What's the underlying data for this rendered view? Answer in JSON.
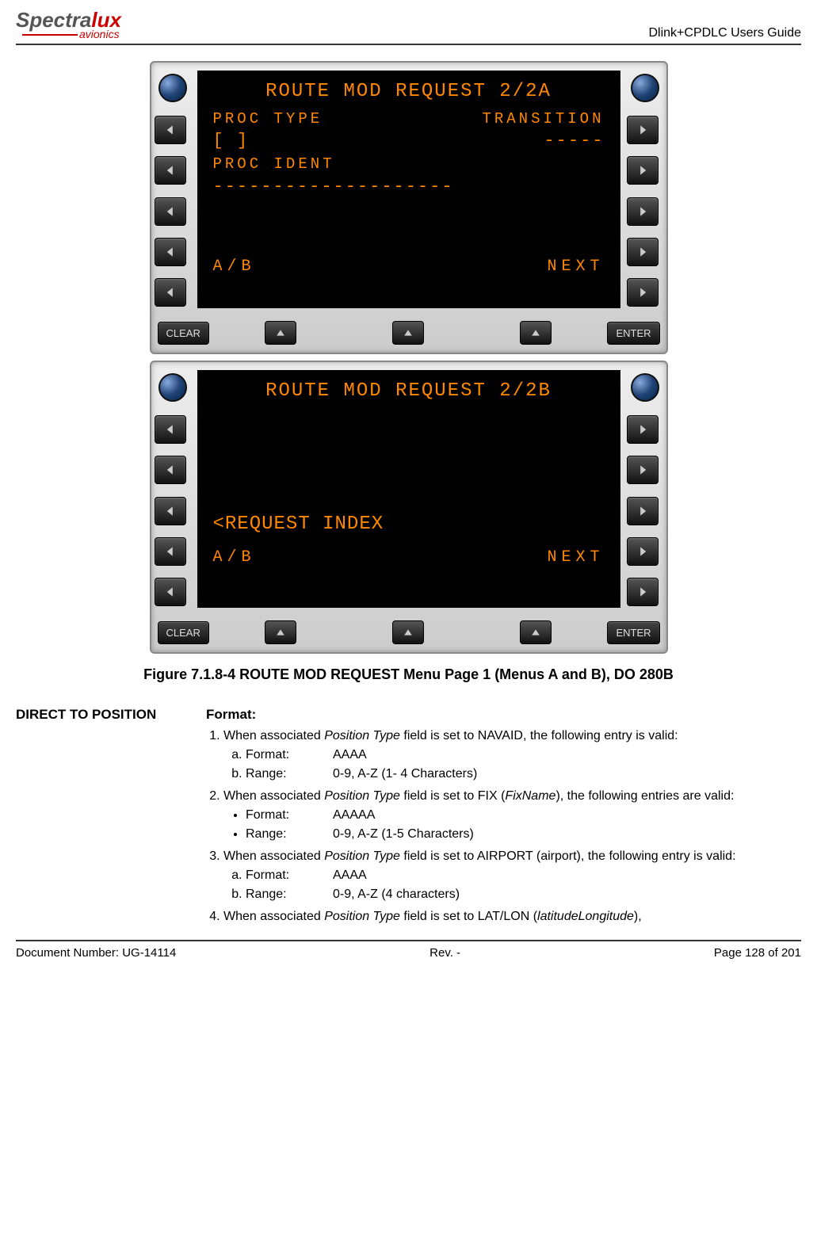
{
  "header": {
    "logo_part1": "Spectra",
    "logo_part2": "lux",
    "logo_sub": "avionics",
    "title": "Dlink+CPDLC Users Guide"
  },
  "cdu_a": {
    "title": "ROUTE MOD REQUEST 2/2A",
    "label_left": "PROC TYPE",
    "label_right": "TRANSITION",
    "field_left": "[        ]",
    "field_right": "-----",
    "label2": "PROC IDENT",
    "field2": "--------------------",
    "soft_left": "A/B",
    "soft_right": "NEXT",
    "btn_clear": "CLEAR",
    "btn_enter": "ENTER"
  },
  "cdu_b": {
    "title": "ROUTE MOD REQUEST 2/2B",
    "prompt": "<REQUEST INDEX",
    "soft_left": "A/B",
    "soft_right": "NEXT",
    "btn_clear": "CLEAR",
    "btn_enter": "ENTER"
  },
  "caption": "Figure 7.1.8-4 ROUTE MOD REQUEST Menu Page 1 (Menus A and B), DO 280B",
  "section": {
    "sidehead": "DIRECT TO POSITION",
    "heading": "Format:",
    "item1_pre": "When associated ",
    "item1_em": "Position Type",
    "item1_post": " field is set to NAVAID, the following entry is valid:",
    "item1a_k": "Format:",
    "item1a_v": "AAAA",
    "item1b_k": "Range:",
    "item1b_v": "0-9, A-Z (1- 4 Characters)",
    "item2_pre": "When associated ",
    "item2_em1": "Position Type",
    "item2_mid": " field is set to FIX (",
    "item2_em2": "FixName",
    "item2_post": "), the following entries are valid:",
    "item2a_k": "Format:",
    "item2a_v": "AAAAA",
    "item2b_k": "Range:",
    "item2b_v": "0-9, A-Z (1-5 Characters)",
    "item3_pre": "When associated ",
    "item3_em": "Position Type",
    "item3_post": " field is set to AIRPORT (airport), the following entry is valid:",
    "item3a_k": "Format:",
    "item3a_v": "AAAA",
    "item3b_k": "Range:",
    "item3b_v": "0-9, A-Z (4 characters)",
    "item4_pre": "When associated ",
    "item4_em1": "Position Type",
    "item4_mid": " field is set to LAT/LON (",
    "item4_em2": "latitudeLongitude",
    "item4_post": "),"
  },
  "footer": {
    "left": "Document Number:  UG-14114",
    "center": "Rev. -",
    "right": "Page 128 of 201"
  }
}
